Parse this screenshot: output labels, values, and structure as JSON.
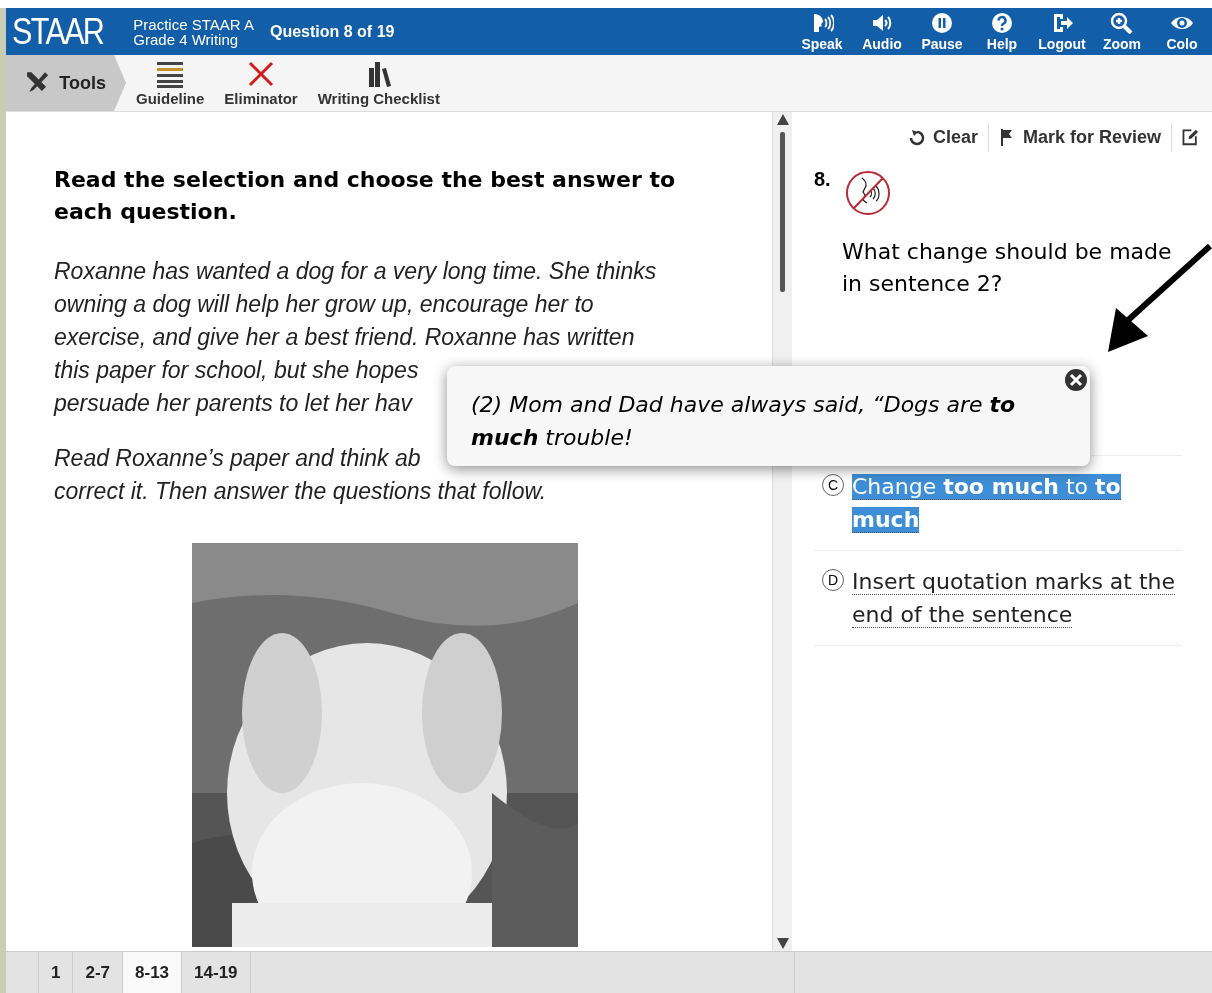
{
  "header": {
    "logo": "STAAR",
    "test_title": [
      "Practice STAAR A",
      "Grade 4 Writing"
    ],
    "question_counter": "Question 8 of 19",
    "actions": [
      {
        "label": "Speak"
      },
      {
        "label": "Audio"
      },
      {
        "label": "Pause"
      },
      {
        "label": "Help"
      },
      {
        "label": "Logout"
      },
      {
        "label": "Zoom"
      },
      {
        "label": "Colo"
      }
    ]
  },
  "toolbar": {
    "tools_label": "Tools",
    "tools": [
      {
        "label": "Guideline"
      },
      {
        "label": "Eliminator"
      },
      {
        "label": "Writing Checklist"
      }
    ]
  },
  "passage": {
    "heading": "Read the selection and choose the best answer to each question.",
    "paragraphs": [
      [
        "Roxanne has wanted a dog for a very long time. She thinks",
        "owning a dog will help her grow up, encourage her to",
        "exercise, and give her a best friend. Roxanne has written",
        "this paper for school, but she hopes",
        "persuade her parents to let her hav"
      ],
      [
        "Read Roxanne’s paper and think ab",
        "correct it. Then answer the questions that follow."
      ]
    ],
    "picture": {
      "kind": "picture"
    }
  },
  "question": {
    "actions": [
      {
        "label": "Clear"
      },
      {
        "label": "Mark for Review"
      }
    ],
    "number": "8.",
    "prompt": "What change should be made in sentence 2?",
    "choices": [
      {
        "letter": "C",
        "highlighted": true,
        "text": "Change **too much** to **to much**"
      },
      {
        "letter": "D",
        "highlighted": false,
        "text": "Insert quotation marks at the end of the sentence"
      }
    ]
  },
  "popover": {
    "text": "(2) Mom and Dad have always said, “Dogs are **to much** trouble!"
  },
  "section_tabs": [
    {
      "label": "1",
      "selected": false
    },
    {
      "label": "2-7",
      "selected": false
    },
    {
      "label": "8-13",
      "selected": true
    },
    {
      "label": "14-19",
      "selected": false
    }
  ]
}
